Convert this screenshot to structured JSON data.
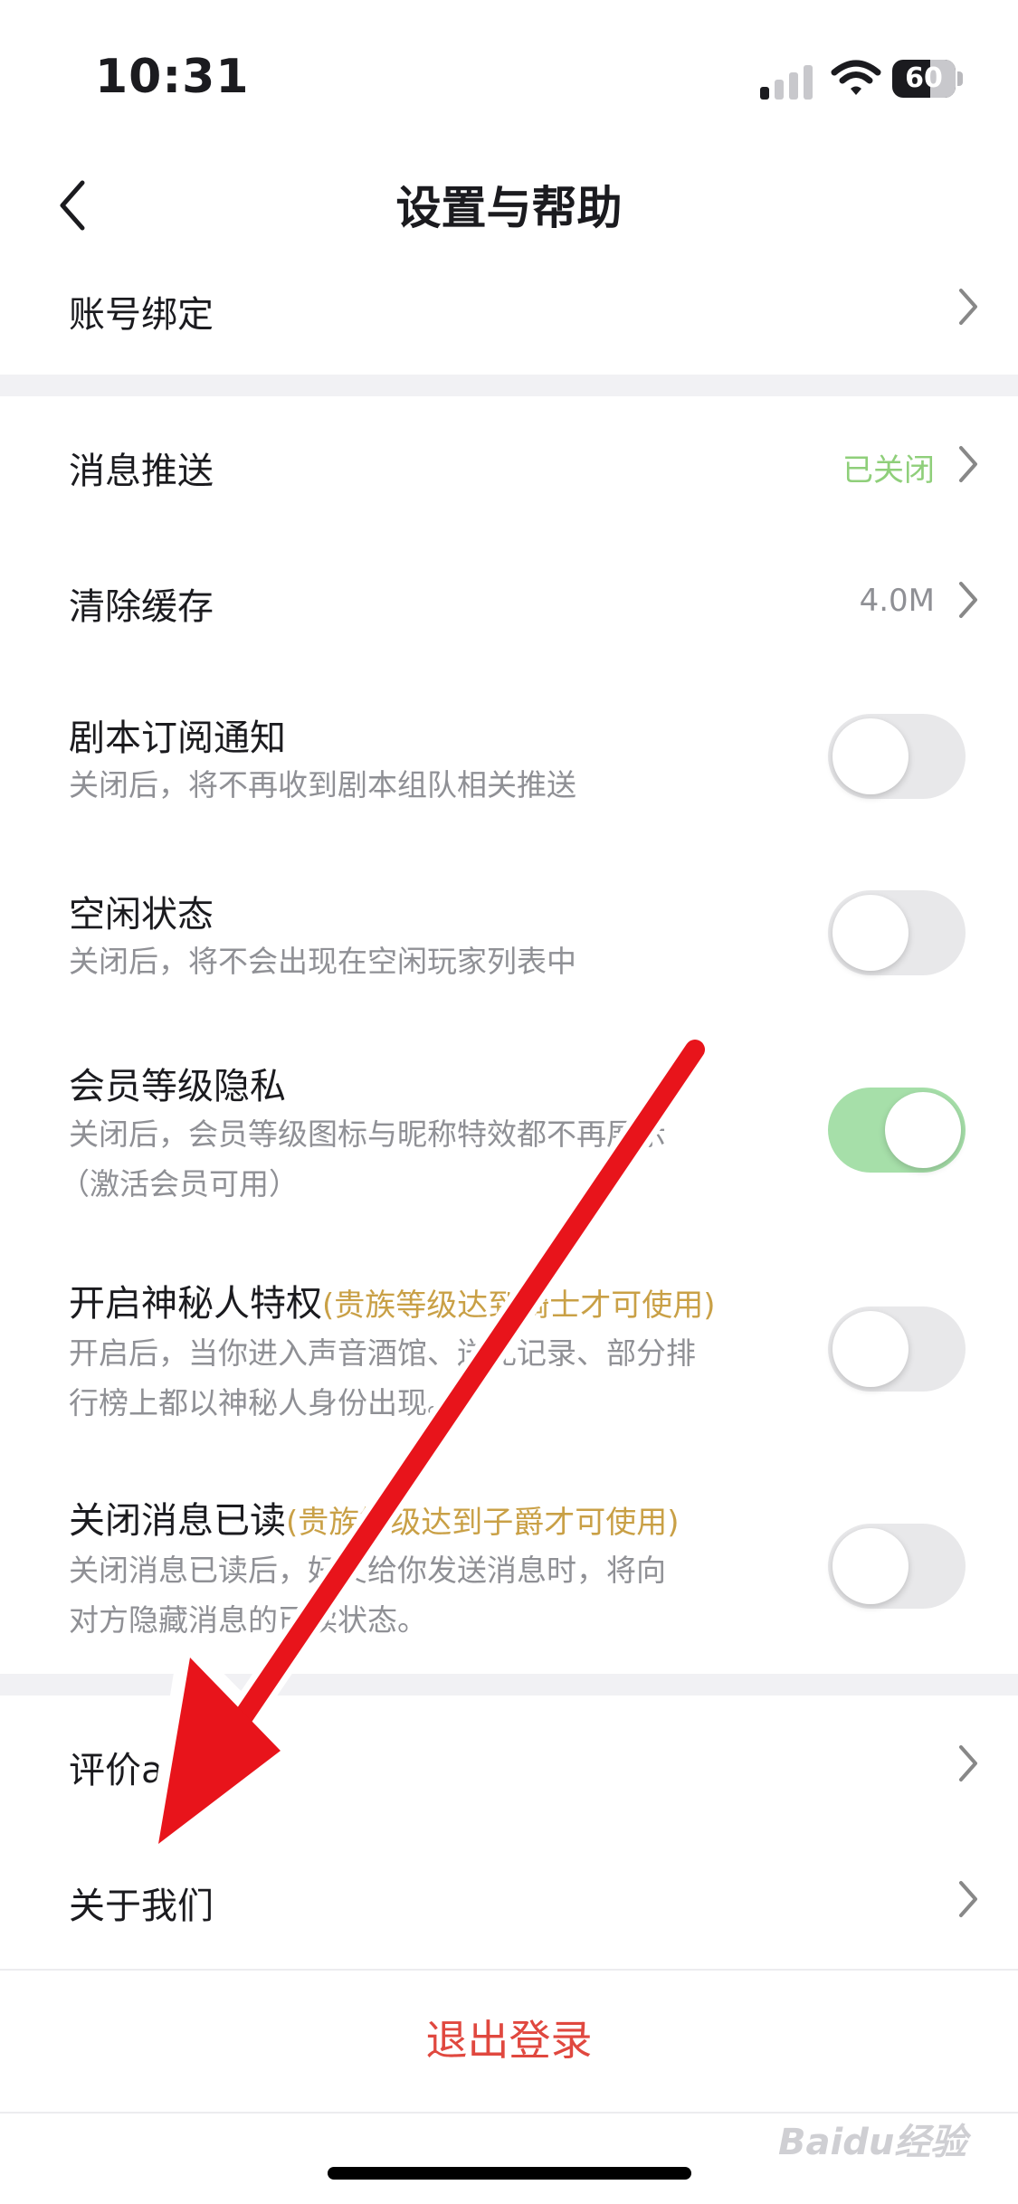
{
  "status_bar": {
    "time": "10:31",
    "battery": "60",
    "battery_level": 0.6
  },
  "nav": {
    "title": "设置与帮助"
  },
  "rows": {
    "account_binding": {
      "label": "账号绑定"
    },
    "push": {
      "label": "消息推送",
      "value": "已关闭"
    },
    "cache": {
      "label": "清除缓存",
      "value": "4.0M"
    },
    "script_notify": {
      "label": "剧本订阅通知",
      "sub": "关闭后，将不再收到剧本组队相关推送",
      "on": false
    },
    "idle": {
      "label": "空闲状态",
      "sub": "关闭后，将不会出现在空闲玩家列表中",
      "on": false
    },
    "vip_privacy": {
      "label": "会员等级隐私",
      "sub1": "关闭后，会员等级图标与昵称特效都不再展示",
      "sub2": "（激活会员可用）",
      "on": true
    },
    "mystery": {
      "label": "开启神秘人特权",
      "note": "(贵族等级达到骑士才可使用)",
      "sub1": "开启后，当你进入声音酒馆、送礼记录、部分排",
      "sub2": "行榜上都以神秘人身份出现。",
      "on": false
    },
    "read_receipt": {
      "label": "关闭消息已读",
      "note": "(贵族等级达到子爵才可使用)",
      "sub1": "关闭消息已读后，好友给你发送消息时，将向",
      "sub2": "对方隐藏消息的已读状态。",
      "on": false
    },
    "rate": {
      "label": "评价app"
    },
    "about": {
      "label": "关于我们"
    }
  },
  "logout": {
    "label": "退出登录"
  },
  "watermark": "Baidu经验",
  "colors": {
    "accent_green": "#8fcf7a",
    "toggle_on": "#a6dfa9",
    "danger": "#e0483f",
    "gold": "#c9a046",
    "arrow": "#e8141b"
  }
}
